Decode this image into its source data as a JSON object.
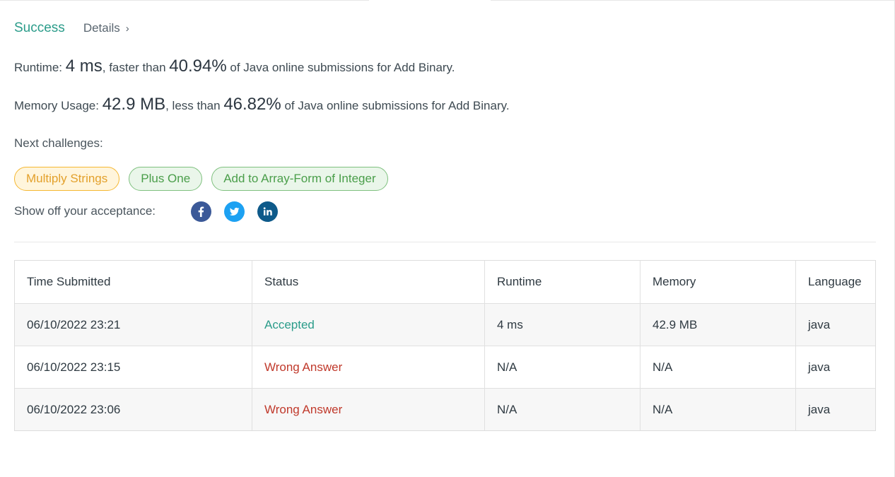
{
  "result": {
    "status": "Success",
    "details_label": "Details",
    "chevron": "›"
  },
  "runtime": {
    "label": "Runtime: ",
    "value": "4 ms",
    "comparator": ", faster than ",
    "percent": "40.94%",
    "suffix": " of Java online submissions for Add Binary."
  },
  "memory": {
    "label": "Memory Usage: ",
    "value": "42.9 MB",
    "comparator": ", less than ",
    "percent": "46.82%",
    "suffix": " of Java online submissions for Add Binary."
  },
  "next_challenges": {
    "label": "Next challenges:",
    "items": [
      {
        "label": "Multiply Strings",
        "difficulty": "medium"
      },
      {
        "label": "Plus One",
        "difficulty": "easy"
      },
      {
        "label": "Add to Array-Form of Integer",
        "difficulty": "easy"
      }
    ]
  },
  "share": {
    "label": "Show off your acceptance:",
    "icons": [
      "facebook-icon",
      "twitter-icon",
      "linkedin-icon"
    ]
  },
  "submissions": {
    "headers": [
      "Time Submitted",
      "Status",
      "Runtime",
      "Memory",
      "Language"
    ],
    "rows": [
      {
        "time": "06/10/2022 23:21",
        "status": "Accepted",
        "runtime": "4 ms",
        "memory": "42.9 MB",
        "language": "java"
      },
      {
        "time": "06/10/2022 23:15",
        "status": "Wrong Answer",
        "runtime": "N/A",
        "memory": "N/A",
        "language": "java"
      },
      {
        "time": "06/10/2022 23:06",
        "status": "Wrong Answer",
        "runtime": "N/A",
        "memory": "N/A",
        "language": "java"
      }
    ]
  },
  "colors": {
    "success": "#2b9c8a",
    "wrong": "#c0392b",
    "medium_chip": "#f5b731",
    "easy_chip": "#7ec07e"
  }
}
